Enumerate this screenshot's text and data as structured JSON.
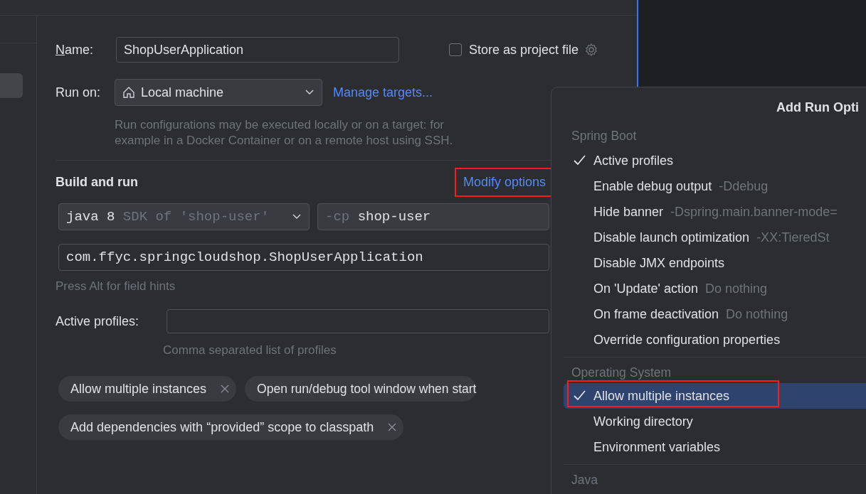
{
  "form": {
    "name_label": "Name:",
    "name_value": "ShopUserApplication",
    "store_checkbox": {
      "label": "Store as project file",
      "checked": false
    },
    "run_on_label": "Run on:",
    "run_on_value": "Local machine",
    "manage_link": "Manage targets...",
    "run_on_description": [
      "Run configurations may be executed locally or on a target: for",
      "example in a Docker Container or on a remote host using SSH."
    ],
    "section_title": "Build and run",
    "modify_options": {
      "label": "Modify options",
      "annotated": true
    },
    "sdk": {
      "value": "java 8",
      "hint": "SDK of 'shop-user'"
    },
    "classpath": {
      "prefix": "-cp",
      "value": "shop-user"
    },
    "main_class": "com.ffyc.springcloudshop.ShopUserApplication",
    "field_hint": "Press Alt for field hints",
    "active_profiles_label": "Active profiles:",
    "active_profiles_hint": "Comma separated list of profiles",
    "chips": [
      {
        "label": "Allow multiple instances"
      },
      {
        "label": "Open run/debug tool window when start"
      },
      {
        "label": "Add dependencies with “provided” scope to classpath"
      }
    ]
  },
  "menu": {
    "title": "Add Run Opti",
    "sections": [
      {
        "heading": "Spring Boot",
        "items": [
          {
            "label": "Active profiles",
            "checked": true,
            "selected": false,
            "annotated": false
          },
          {
            "label": "Enable debug output",
            "hint": "-Ddebug",
            "checked": false,
            "selected": false,
            "annotated": false
          },
          {
            "label": "Hide banner",
            "hint": "-Dspring.main.banner-mode=",
            "checked": false,
            "selected": false,
            "annotated": false
          },
          {
            "label": "Disable launch optimization",
            "hint": "-XX:TieredSt",
            "checked": false,
            "selected": false,
            "annotated": false
          },
          {
            "label": "Disable JMX endpoints",
            "checked": false,
            "selected": false,
            "annotated": false
          },
          {
            "label": "On 'Update' action",
            "hint": "Do nothing",
            "checked": false,
            "selected": false,
            "annotated": false
          },
          {
            "label": "On frame deactivation",
            "hint": "Do nothing",
            "checked": false,
            "selected": false,
            "annotated": false
          },
          {
            "label": "Override configuration properties",
            "checked": false,
            "selected": false,
            "annotated": false
          }
        ]
      },
      {
        "heading": "Operating System",
        "items": [
          {
            "label": "Allow multiple instances",
            "checked": true,
            "selected": true,
            "annotated": true
          },
          {
            "label": "Working directory",
            "checked": false,
            "selected": false,
            "annotated": false
          },
          {
            "label": "Environment variables",
            "checked": false,
            "selected": false,
            "annotated": false
          }
        ]
      },
      {
        "heading": "Java"
      }
    ]
  }
}
